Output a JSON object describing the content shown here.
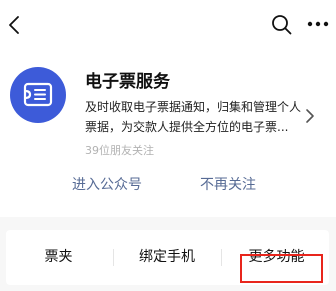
{
  "topbar": {
    "back_icon": "chevron-left-icon",
    "search_icon": "search-icon",
    "more_icon": "more-dots-icon"
  },
  "profile": {
    "name": "电子票服务",
    "description": "及时收取电子票据通知，归集和管理个人票据，为交款人提供全方位的电子票...",
    "followers": "39位朋友关注",
    "avatar_icon": "receipt-document-icon",
    "avatar_color": "#3d5bd9"
  },
  "actions": {
    "enter_label": "进入公众号",
    "unfollow_label": "不再关注"
  },
  "menu": {
    "items": [
      {
        "label": "票夹"
      },
      {
        "label": "绑定手机"
      },
      {
        "label": "更多功能"
      }
    ],
    "highlight_color": "#e8251c"
  },
  "colors": {
    "link": "#576b95",
    "muted": "#b2b2b2",
    "footer_bg": "#f7f7f7"
  }
}
